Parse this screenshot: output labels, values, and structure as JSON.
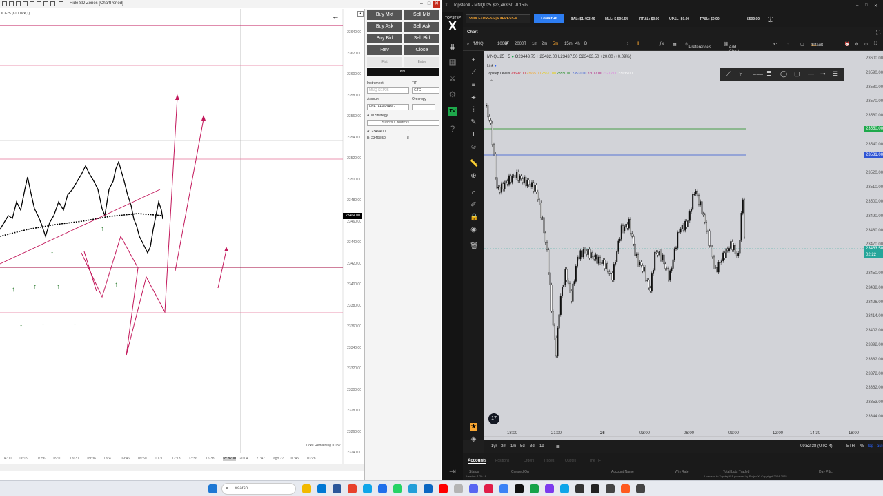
{
  "left_window": {
    "title": "Hide SD Zones [ChartPeriod]",
    "chart_info": "ICF25 (610 Tick,1)",
    "ticks_remaining": "Ticks Remaining = 157",
    "price_tag": "23464.00",
    "y_labels": [
      "23640.00",
      "23620.00",
      "23600.00",
      "23580.00",
      "23560.00",
      "23540.00",
      "23520.00",
      "23500.00",
      "23480.00",
      "23460.00",
      "23440.00",
      "23420.00",
      "23400.00",
      "23380.00",
      "23360.00",
      "23340.00",
      "23320.00",
      "23300.00",
      "23280.00",
      "23260.00",
      "23240.00"
    ],
    "x_labels": [
      "04:00",
      "06:09",
      "07:56",
      "09:01",
      "09:31",
      "09:36",
      "09:41",
      "09:46",
      "09:50",
      "10:30",
      "12:13",
      "13:56",
      "15:38",
      "18:26:00",
      "20:04",
      "21:47",
      "ago 27",
      "01:45",
      "03:28"
    ]
  },
  "trader": {
    "buy_mkt": "Buy Mkt",
    "sell_mkt": "Sell Mkt",
    "buy_ask": "Buy Ask",
    "sell_ask": "Sell Ask",
    "buy_bid": "Buy Bid",
    "sell_bid": "Sell Bid",
    "rev": "Rev",
    "close": "Close",
    "flat": "Flat",
    "entry": "Entry",
    "pnl": "PnL",
    "instrument_label": "Instrument",
    "instrument_value": "MNQ SEP25",
    "tif_label": "TIF",
    "tif_value": "GTC",
    "account_label": "Account",
    "account_value": "FNFTFAARIANG...",
    "order_qty_label": "Order qty",
    "order_qty_value": "1",
    "atm_label": "ATM Strategy",
    "atm_value": "150ticks x 300ticks",
    "ask_label": "A: 23464.00",
    "ask_size": "7",
    "bid_label": "B: 23463.50",
    "bid_size": "8"
  },
  "right_window": {
    "title": "TopstepX - MNQU25 $23,463.50 -0.15%",
    "brand": "TOPSTEP",
    "account_select": "$50K EXPRESS | EXPRESS-V...",
    "leader_badge": "Leader +6",
    "bal": "BAL: $1,403.46",
    "mll": "MLL: $-596.54",
    "rpnl": "RP&L: $0.00",
    "upnl": "UP&L: $0.00",
    "tpnl": "TP&L: $0.00",
    "extra": "$500.00",
    "chart_tab": "Chart",
    "symbol": "/MNQ",
    "timeframes": [
      "1000T",
      "2000T",
      "1m",
      "2m",
      "5m",
      "15m",
      "4h",
      "D"
    ],
    "preferences": "Preferences",
    "add_chart_link": "Add Chart Link",
    "layout_name": "default",
    "layout_sub": "Save",
    "chart_symbol": "MNQU25 · 5",
    "ohlc": "O23443.75 H23482.00 L23437.50 C23463.50 +20.00 (+0.09%)",
    "link": "Link",
    "levels_label": "Topstep Levels",
    "levels": [
      {
        "v": "23692.00",
        "c": "#d0021b"
      },
      {
        "v": "23655.00",
        "c": "#f5a623"
      },
      {
        "v": "23611.00",
        "c": "#e8d000"
      },
      {
        "v": "23550.00",
        "c": "#1a8a1a"
      },
      {
        "v": "23531.00",
        "c": "#2f55d4"
      },
      {
        "v": "23077.00",
        "c": "#b0107a"
      },
      {
        "v": "23212.00",
        "c": "#e07ae0"
      },
      {
        "v": "23035.00",
        "c": "#ffffff"
      }
    ],
    "y_labels": [
      "23600.00",
      "23590.00",
      "23580.00",
      "23570.00",
      "23560.00",
      "23550.00",
      "23540.00",
      "23531.00",
      "23520.00",
      "23510.00",
      "23500.00",
      "23490.00",
      "23480.00",
      "23470.00",
      "23463.50",
      "23450.00",
      "23438.00",
      "23426.00",
      "23414.00",
      "23402.00",
      "23392.00",
      "23382.00",
      "23372.00",
      "23362.00",
      "23353.00",
      "23344.00"
    ],
    "tag_green": "23550.00",
    "tag_blue": "23531.00",
    "tag_price": "23463.50",
    "tag_countdown": "02:22",
    "x_labels": [
      "18:00",
      "21:00",
      "26",
      "03:00",
      "06:00",
      "09:00",
      "12:00",
      "14:30",
      "18:00"
    ],
    "ranges": [
      "1yr",
      "3m",
      "1m",
      "5d",
      "3d",
      "1d"
    ],
    "clock": "09:52:38 (UTC-4)",
    "session": "ETH",
    "pct": "%",
    "log": "log",
    "auto": "auto",
    "bottom_tabs": [
      "Accounts",
      "Positions",
      "Orders",
      "Trades",
      "Quotes",
      "The TiF"
    ],
    "bottom_headers": [
      "Status",
      "Created On",
      "Account Name",
      "Win Rate",
      "Total Lots Traded",
      "Day P&L"
    ],
    "version": "Version: 1.20.18",
    "license": "Licensed to TopstepX & powered by ProjectX. Copyright 2024-2025"
  },
  "taskbar": {
    "search_placeholder": "Search"
  }
}
